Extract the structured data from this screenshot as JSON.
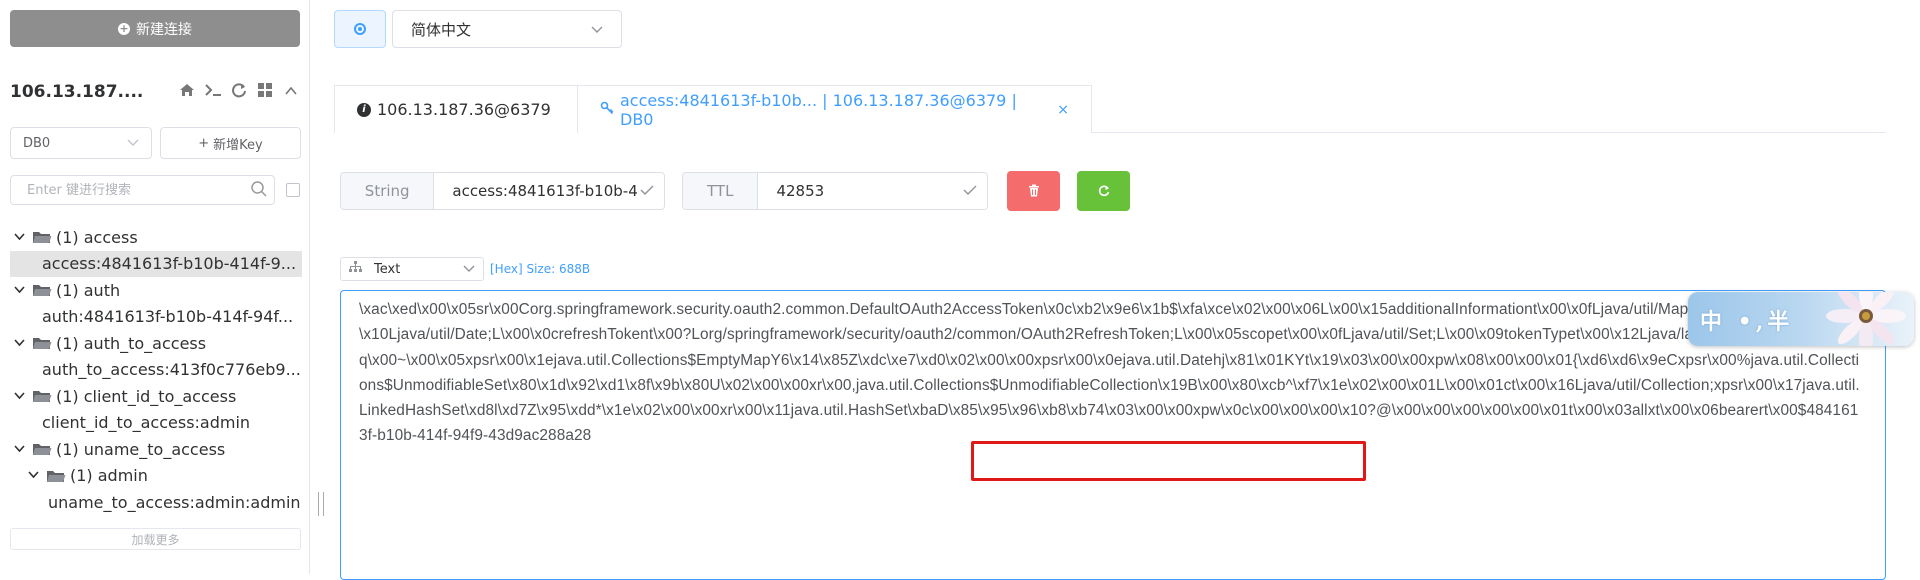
{
  "sidebar": {
    "new_connection_label": "新建连接",
    "server_name": "106.13.187....",
    "db_select_value": "DB0",
    "new_key_label": "新增Key",
    "search_placeholder": "Enter 键进行搜索",
    "load_more_label": "加载更多",
    "tree": [
      {
        "kind": "folder",
        "label": "(1)  access"
      },
      {
        "kind": "leaf",
        "label": "access:4841613f-b10b-414f-9...",
        "selected": true
      },
      {
        "kind": "folder",
        "label": "(1)  auth"
      },
      {
        "kind": "leaf",
        "label": "auth:4841613f-b10b-414f-94f..."
      },
      {
        "kind": "folder",
        "label": "(1)  auth_to_access"
      },
      {
        "kind": "leaf",
        "label": "auth_to_access:413f0c776eb9..."
      },
      {
        "kind": "folder",
        "label": "(1)  client_id_to_access"
      },
      {
        "kind": "leaf",
        "label": "client_id_to_access:admin"
      },
      {
        "kind": "folder",
        "label": "(1)  uname_to_access"
      },
      {
        "kind": "sub-folder",
        "label": "(1)  admin"
      },
      {
        "kind": "sub-leaf",
        "label": "uname_to_access:admin:admin"
      }
    ]
  },
  "topbar": {
    "language_value": "简体中文"
  },
  "tabs": [
    {
      "label": "106.13.187.36@6379",
      "active": false
    },
    {
      "label": "access:4841613f-b10b... | 106.13.187.36@6379 | DB0",
      "active": true
    }
  ],
  "key_info": {
    "type_label": "String",
    "key_name": "access:4841613f-b10b-4",
    "ttl_label": "TTL",
    "ttl_value": "42853"
  },
  "formatter": {
    "selected": "Text",
    "info": "[Hex] Size: 688B"
  },
  "value": {
    "text": "\\xac\\xed\\x00\\x05sr\\x00Corg.springframework.security.oauth2.common.DefaultOAuth2AccessToken\\x0c\\xb2\\x9e6\\x1b$\\xfa\\xce\\x02\\x00\\x06L\\x00\\x15additionalInformationt\\x00\\x0fLjava/util/Map;L\\x00\\x0aexpirationt\\x00\\x10Ljava/util/Date;L\\x00\\x0crefreshTokent\\x00?Lorg/springframework/security/oauth2/common/OAuth2RefreshToken;L\\x00\\x05scopet\\x00\\x0fLjava/util/Set;L\\x00\\x09tokenTypet\\x00\\x12Ljava/lang/String;L\\x00\\x05valueq\\x00~\\x00\\x05xpsr\\x00\\x1ejava.util.Collections$EmptyMapY6\\x14\\x85Z\\xdc\\xe7\\xd0\\x02\\x00\\x00xpsr\\x00\\x0ejava.util.Datehj\\x81\\x01KYt\\x19\\x03\\x00\\x00xpw\\x08\\x00\\x00\\x01{\\xd6\\xd6\\x9eCxpsr\\x00%java.util.Collections$UnmodifiableSet\\x80\\x1d\\x92\\xd1\\x8f\\x9b\\x80U\\x02\\x00\\x00xr\\x00,java.util.Collections$UnmodifiableCollection\\x19B\\x00\\x80\\xcb^\\xf7\\x1e\\x02\\x00\\x01L\\x00\\x01ct\\x00\\x16Ljava/util/Collection;xpsr\\x00\\x17java.util.LinkedHashSet\\xd8l\\xd7Z\\x95\\xdd*\\x1e\\x02\\x00\\x00xr\\x00\\x11java.util.HashSet\\xbaD\\x85\\x95\\x96\\xb8\\xb74\\x03\\x00\\x00xpw\\x0c\\x00\\x00\\x00\\x10?@\\x00\\x00\\x00\\x00\\x00\\x01t\\x00\\x03allxt\\x00\\x06bearert\\x00$4841613f-b10b-414f-94f9-43d9ac288a28"
  },
  "ime": {
    "label": "中 •,半"
  },
  "colors": {
    "primary": "#409eff",
    "danger": "#f56c6c",
    "success": "#67c23a",
    "new_conn_bg": "#8e8e8e",
    "highlight": "#e01818"
  }
}
